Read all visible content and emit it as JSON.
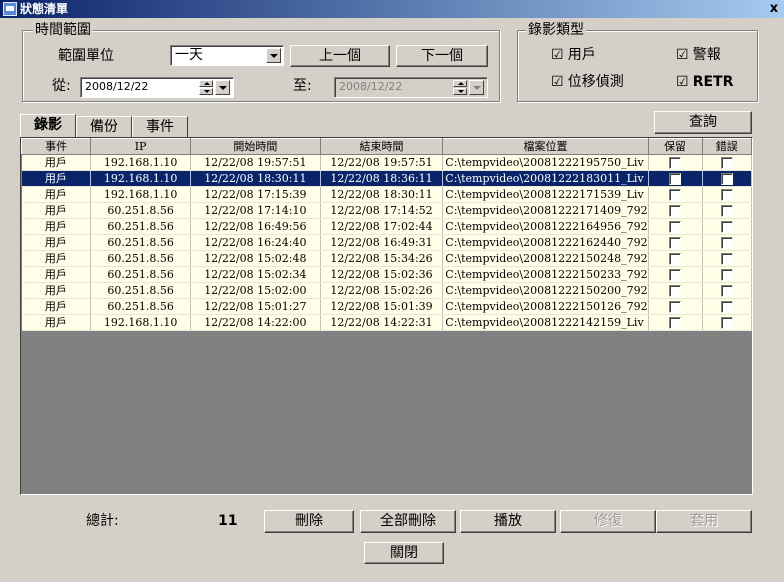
{
  "window": {
    "title": "狀態清單",
    "close_label": "x"
  },
  "time_range": {
    "legend": "時間範圍",
    "unit_label": "範圍單位",
    "unit_value": "一天",
    "prev_label": "上一個",
    "next_label": "下一個",
    "from_label": "從:",
    "from_value": "2008/12/22",
    "to_label": "至:",
    "to_value": "2008/12/22"
  },
  "record_type": {
    "legend": "錄影類型",
    "options": [
      {
        "label": "用戶",
        "checked": true
      },
      {
        "label": "警報",
        "checked": true
      },
      {
        "label": "位移偵測",
        "checked": true
      },
      {
        "label": "RETR",
        "checked": true
      }
    ],
    "check_glyph": "☑"
  },
  "tabs": [
    {
      "label": "錄影",
      "active": true
    },
    {
      "label": "備份",
      "active": false
    },
    {
      "label": "事件",
      "active": false
    }
  ],
  "query_label": "查詢",
  "table": {
    "columns": [
      "事件",
      "IP",
      "開始時間",
      "結束時間",
      "檔案位置",
      "保留",
      "錯誤"
    ],
    "rows": [
      [
        "用戶",
        "192.168.1.10",
        "12/22/08 19:57:51",
        "12/22/08 19:57:51",
        "C:\\tempvideo\\20081222195750_Liv"
      ],
      [
        "用戶",
        "192.168.1.10",
        "12/22/08 18:30:11",
        "12/22/08 18:36:11",
        "C:\\tempvideo\\20081222183011_Liv"
      ],
      [
        "用戶",
        "192.168.1.10",
        "12/22/08 17:15:39",
        "12/22/08 18:30:11",
        "C:\\tempvideo\\20081222171539_Liv"
      ],
      [
        "用戶",
        "60.251.8.56",
        "12/22/08 17:14:10",
        "12/22/08 17:14:52",
        "C:\\tempvideo\\20081222171409_792"
      ],
      [
        "用戶",
        "60.251.8.56",
        "12/22/08 16:49:56",
        "12/22/08 17:02:44",
        "C:\\tempvideo\\20081222164956_792"
      ],
      [
        "用戶",
        "60.251.8.56",
        "12/22/08 16:24:40",
        "12/22/08 16:49:31",
        "C:\\tempvideo\\20081222162440_792"
      ],
      [
        "用戶",
        "60.251.8.56",
        "12/22/08 15:02:48",
        "12/22/08 15:34:26",
        "C:\\tempvideo\\20081222150248_792"
      ],
      [
        "用戶",
        "60.251.8.56",
        "12/22/08 15:02:34",
        "12/22/08 15:02:36",
        "C:\\tempvideo\\20081222150233_792"
      ],
      [
        "用戶",
        "60.251.8.56",
        "12/22/08 15:02:00",
        "12/22/08 15:02:26",
        "C:\\tempvideo\\20081222150200_792"
      ],
      [
        "用戶",
        "60.251.8.56",
        "12/22/08 15:01:27",
        "12/22/08 15:01:39",
        "C:\\tempvideo\\20081222150126_792"
      ],
      [
        "用戶",
        "192.168.1.10",
        "12/22/08 14:22:00",
        "12/22/08 14:22:31",
        "C:\\tempvideo\\20081222142159_Liv"
      ]
    ],
    "selected_row": 1
  },
  "footer": {
    "total_label": "總計:",
    "total_value": "11",
    "delete_label": "刪除",
    "delete_all_label": "全部刪除",
    "play_label": "播放",
    "repair_label": "修復",
    "apply_label": "套用",
    "close_label": "關閉"
  },
  "colors": {
    "selection": "#0a246a",
    "row_bg": "#ffffe8",
    "window_bg": "#d4d0c8"
  }
}
